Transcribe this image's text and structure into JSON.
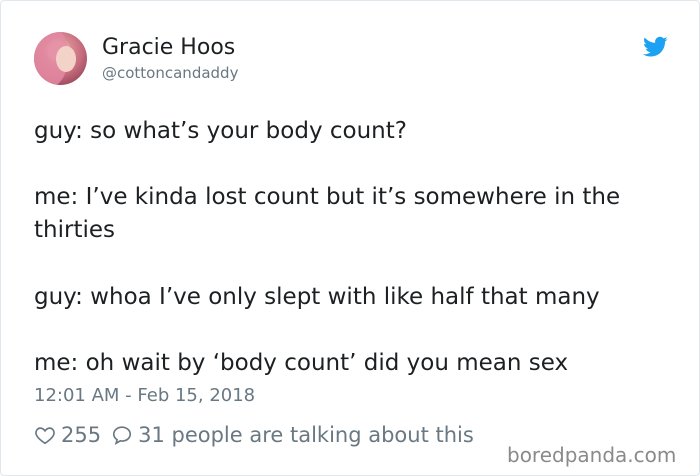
{
  "author": {
    "name": "Gracie Hoos",
    "handle": "@cottoncandaddy",
    "avatar_icon": "profile-photo",
    "platform_icon": "twitter-bird-icon",
    "platform_color": "#1da1f2"
  },
  "tweet": {
    "lines": [
      "guy: so what’s your body count?",
      "me: I’ve kinda lost count but it’s somewhere in the",
      "thirties",
      "guy: whoa I’ve only slept with like half that many",
      "me: oh wait by ‘body count’ did you mean sex"
    ],
    "timestamp": "12:01 AM - Feb 15, 2018",
    "likes": "255",
    "talking": "31 people are talking about this"
  },
  "watermark": "boredpanda.com"
}
